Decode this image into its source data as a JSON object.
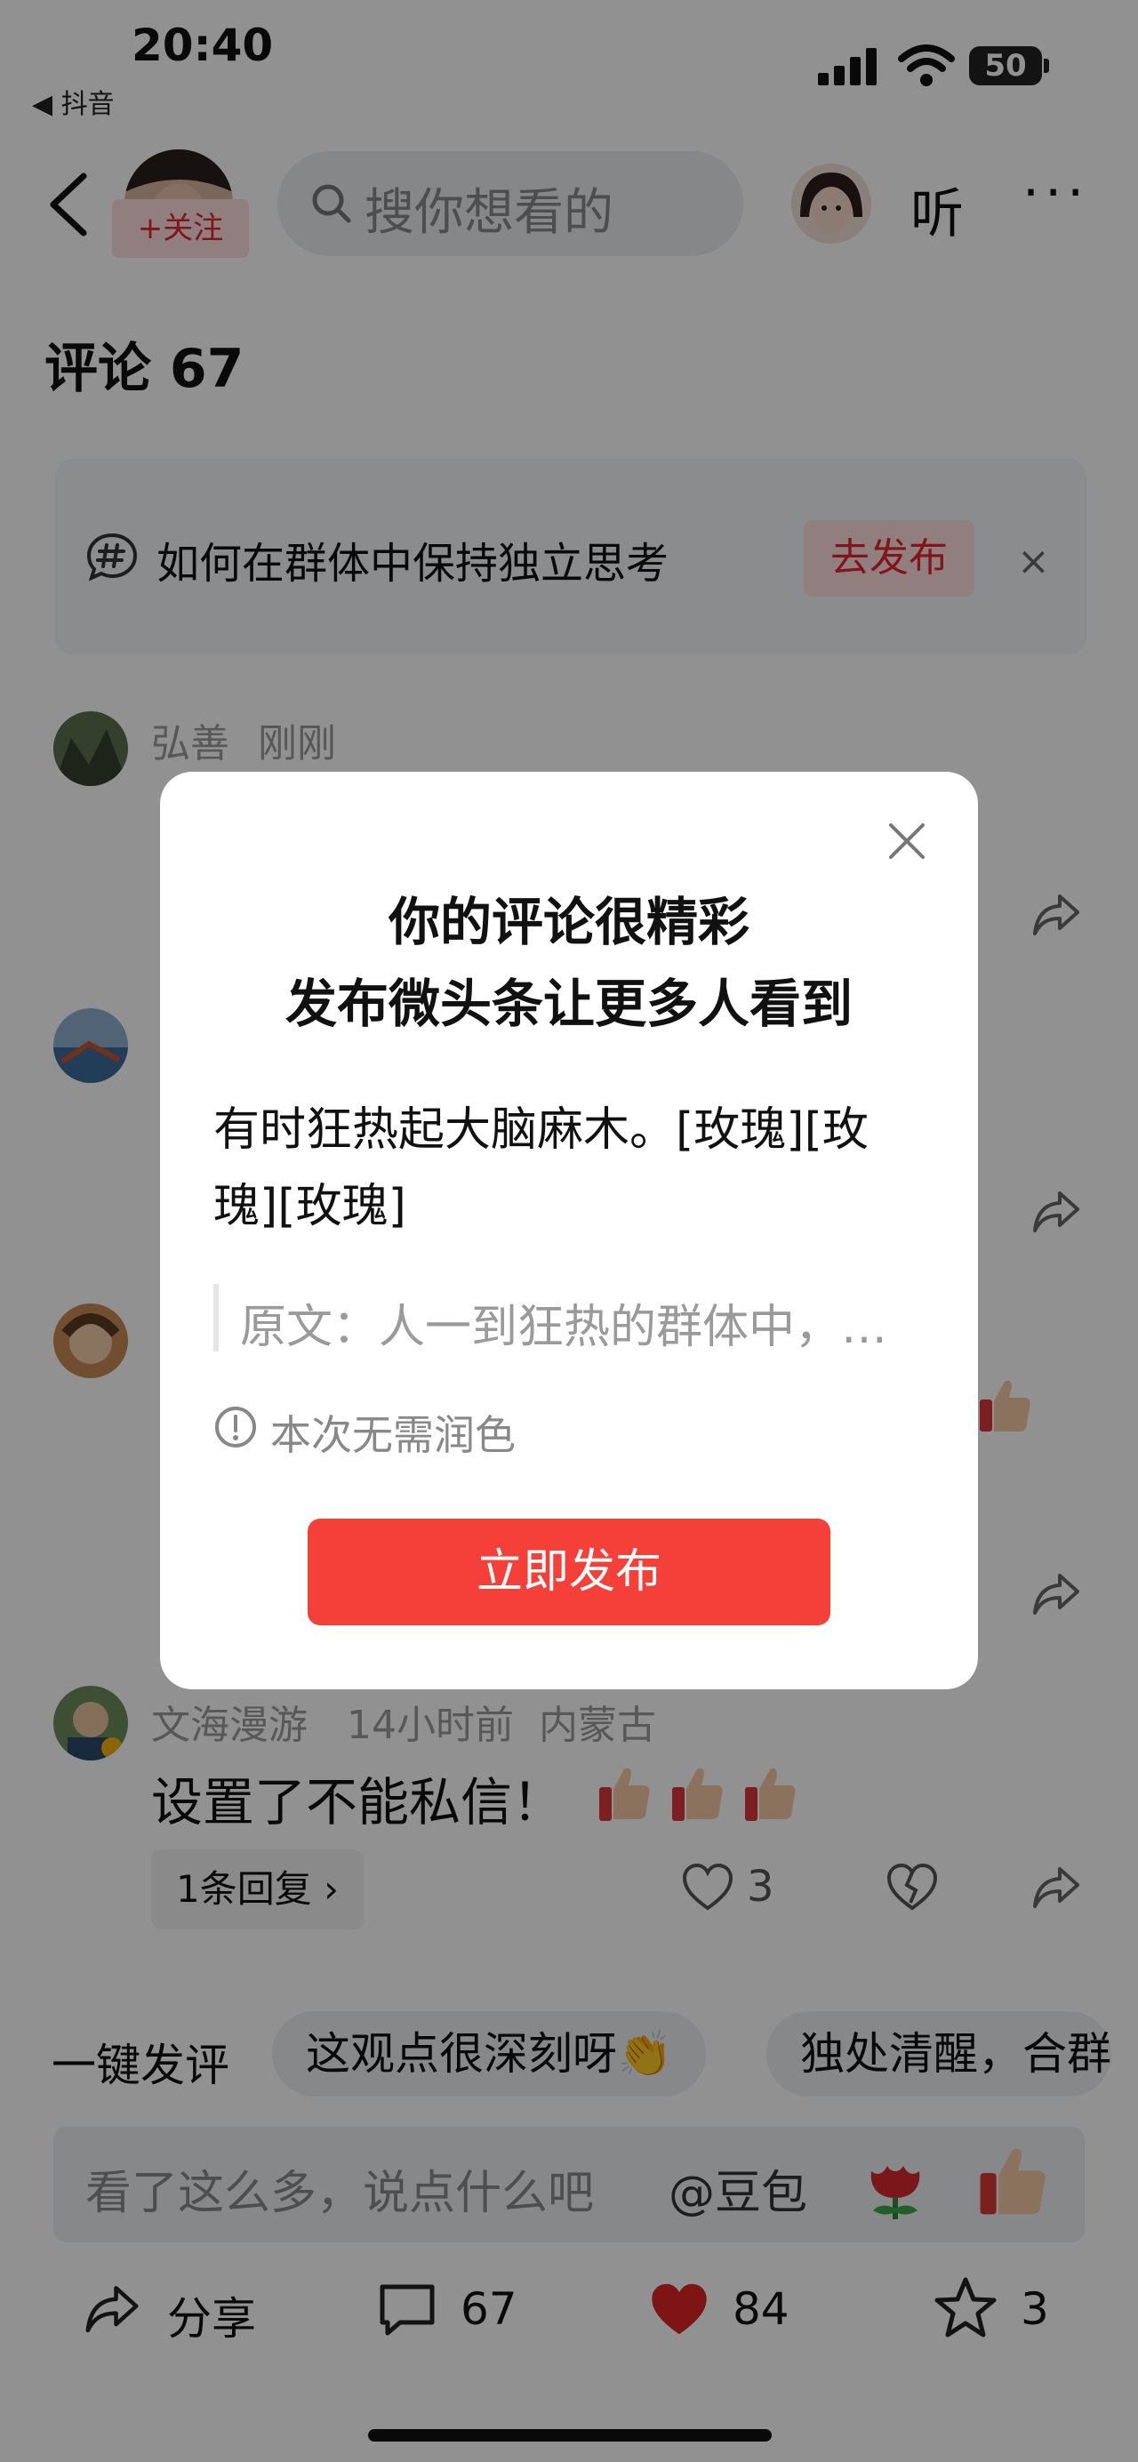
{
  "status_bar": {
    "time": "20:40",
    "back_app": "◀ 抖音",
    "battery": "50"
  },
  "header": {
    "follow_label": "+关注",
    "search_placeholder": "搜你想看的",
    "listen_label": "听",
    "more_label": "···"
  },
  "comments": {
    "title": "评论 67",
    "topic": {
      "text": "如何在群体中保持独立思考",
      "button": "去发布",
      "close": "×"
    },
    "items": [
      {
        "name": "弘善",
        "meta": "刚刚"
      },
      {
        "name": "文海漫游",
        "meta": "14小时前  内蒙古",
        "body": "设置了不能私信！",
        "replies": "1条回复 ›",
        "likes": "3"
      }
    ]
  },
  "quick_comment": {
    "label": "一键发评",
    "chips": [
      "这观点很深刻呀👏",
      "独处清醒，合群"
    ]
  },
  "input": {
    "placeholder": "看了这么多，说点什么吧",
    "at": "@豆包"
  },
  "bottom_bar": {
    "share": "分享",
    "comments": "67",
    "likes": "84",
    "favorites": "3"
  },
  "modal": {
    "title_line1": "你的评论很精彩",
    "title_line2": "发布微头条让更多人看到",
    "body": "有时狂热起大脑麻木。[玫瑰][玫瑰][玫瑰]",
    "quote": "原文：人一到狂热的群体中，…",
    "hint": "本次无需润色",
    "publish_button": "立即发布"
  },
  "colors": {
    "accent": "#f5403a",
    "follow": "#e3262c",
    "like": "#e02424"
  }
}
